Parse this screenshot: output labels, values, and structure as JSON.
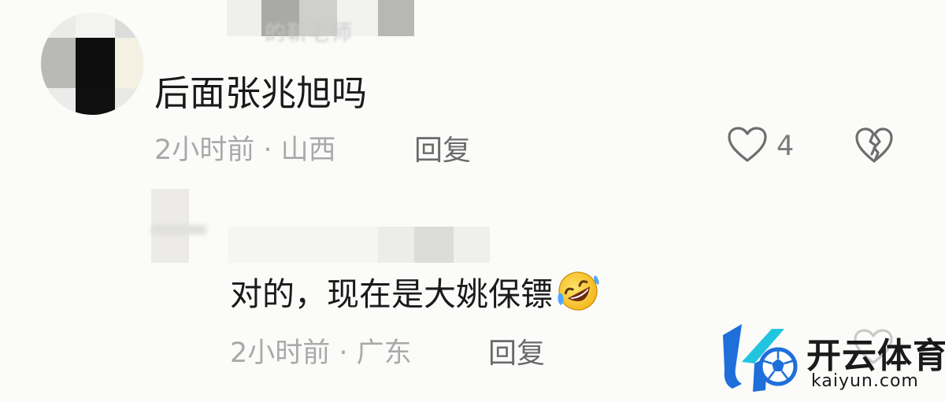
{
  "comments": [
    {
      "author_blurred": "的靳老师",
      "text": "后面张兆旭吗",
      "time_location": "2小时前 · 山西",
      "reply_label": "回复",
      "like_count": "4",
      "icons": [
        "heart-outline-icon",
        "broken-heart-icon"
      ]
    },
    {
      "text": "对的，现在是大姚保镖",
      "emoji": "rolling-on-floor-laughing-emoji",
      "time_location": "2小时前 · 广东",
      "reply_label": "回复"
    }
  ],
  "watermark": {
    "brand_cn": "开云体育",
    "brand_en": "kaiyun.com"
  },
  "colors": {
    "background": "#fbfbf9",
    "text": "#1a1a1a",
    "meta": "#a9a9a9",
    "watermark_blue": "#1e6fd9",
    "watermark_cyan": "#22c5e0"
  }
}
